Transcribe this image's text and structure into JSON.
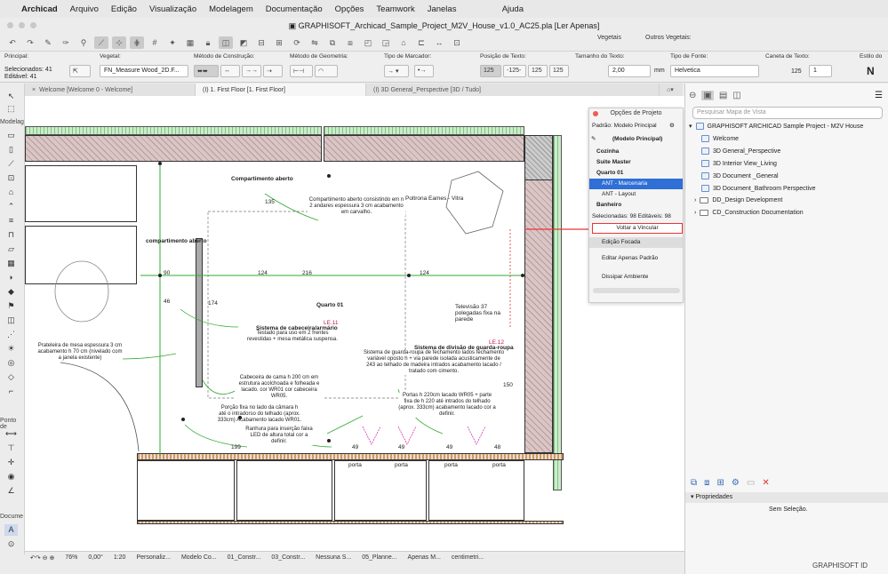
{
  "menu": {
    "app": "Archicad",
    "items": [
      "Arquivo",
      "Edição",
      "Visualização",
      "Modelagem",
      "Documentação",
      "Opções",
      "Teamwork",
      "Janelas"
    ],
    "help": "Ajuda"
  },
  "window": {
    "title": "GRAPHISOFT_Archicad_Sample_Project_M2V_House_v1.0_AC25.pla [Ler Apenas]"
  },
  "toolbar": {
    "vegetais": "Vegetais",
    "vegetais2": "Outros Vegetais:"
  },
  "infobox": {
    "principal": "Principal:",
    "selecionados": "Selecionados: 41",
    "editavel": "Editável: 41",
    "vegetal": "Vegetal:",
    "vegetal_value": "FN_Measure Wood_2D.F...",
    "metodo_construcao": "Método de Construção:",
    "metodo_geometria": "Método de Geometria:",
    "tipo_marcador": "Tipo de Marcador:",
    "posicao_texto": "Posição de Texto:",
    "tamanho_texto": "Tamanho do Texto:",
    "tamanho_value": "2,00",
    "tamanho_unit": "mm",
    "tipo_fonte": "Tipo de Fonte:",
    "fonte_value": "Helvetica",
    "caneta": "Caneta de Texto:",
    "caneta_value": "1",
    "estilo": "Estilo do",
    "pos_a": "125",
    "pos_b": "-125-",
    "pos_c": "125",
    "pos_d": "125",
    "n_label": "N"
  },
  "tabs": [
    {
      "label": "Welcome [Welcome 0 - Welcome]",
      "active": false
    },
    {
      "label": "(I) 1. First Floor [1. First Floor]",
      "active": true
    },
    {
      "label": "(I) 3D General_Perspective [3D / Tudo]",
      "active": false
    }
  ],
  "toolbox": {
    "modelagem": "Modelag",
    "ponto": "Ponto de",
    "docu": "Docume"
  },
  "project_options": {
    "title": "Opções de Projeto",
    "padrao": "Padrão: Modelo Principal",
    "rows": [
      "(Modelo Principal)",
      "Cozinha",
      "Suite Master",
      "Quarto 01",
      "ANT - Marcenaria",
      "ANT - Layout",
      "Banheiro"
    ],
    "selecionadas": "Selecionadas: 98 Editáveis: 98",
    "voltar": "Voltar a Vincular",
    "edicao": "Edição Focada",
    "editar": "Editar Apenas Padrão",
    "dissipar": "Dissipar Ambiente"
  },
  "navigator": {
    "search_placeholder": "Pesquisar Mapa de Vista",
    "root": "GRAPHISOFT ARCHICAD Sample Project - M2V House",
    "items": [
      "Welcome",
      "3D General_Perspective",
      "3D Interior View_Living",
      "3D Document _General",
      "3D Document_Bathroom Perspective"
    ],
    "folders": [
      "DD_Design Development",
      "CD_Construction Documentation"
    ],
    "propriedades": "Propriedades",
    "sem_selecao": "Sem Seleção."
  },
  "drawing": {
    "labels": [
      "Compartimento aberto",
      "Poltrona Eames - Vitra",
      "compartimento aberto",
      "Quarto 01",
      "Televisão 37 polegadas fixa na parede",
      "Sistema de cabeceira/armário",
      "Sistema de divisão de guarda-roupa"
    ],
    "notes": [
      "Compartimento aberto consistindo em n 2 andares espessura 3 cm acabamento em carvalho.",
      "Testado para uso em 2 frentes revestidas + mesa metálica suspensa.",
      "Prateleira de mesa espessura 3 cm acabamento h 70 cm (nivelado com a janela existente)",
      "Sistema de guarda-roupa de fechamento lados fechamento variável oposto h + via parede isolada acusticamente de 243 ao telhado de madeira intrados acabamento lacado / tratado com cimento.",
      "Cabeceira de cama h 200 cm em estrutura acolchoada e folheada e lacado. cor WR01 cor cabeceira WR05.",
      "Portas h 220cm lacado WR05 + parte fixa de h 220 até intrados do telhado (aprox. 333cm) acabamento lacado cor a definir.",
      "Porção fixa no lado da câmara h até o intradorso do telhado (aprox. 333cm) Acabamento lacado WR01.",
      "Ranhura para inserção faixa LED de altura total cor a definir."
    ],
    "dims": [
      "135",
      "124",
      "216",
      "124",
      "90",
      "174",
      "150",
      "199",
      "49",
      "49",
      "49",
      "48",
      "46"
    ],
    "tags": [
      "LE.11",
      "LE.12"
    ],
    "portas": [
      "porta",
      "porta",
      "porta",
      "porta"
    ]
  },
  "status": {
    "zoom": "76%",
    "angle": "0,00°",
    "scale": "1:20",
    "items": [
      "Personaliz...",
      "Modelo Co...",
      "01_Constr...",
      "03_Constr...",
      "Nessuna S...",
      "05_Planne...",
      "Apenas M...",
      "centimetri..."
    ]
  },
  "brand": "GRAPHISOFT ID"
}
